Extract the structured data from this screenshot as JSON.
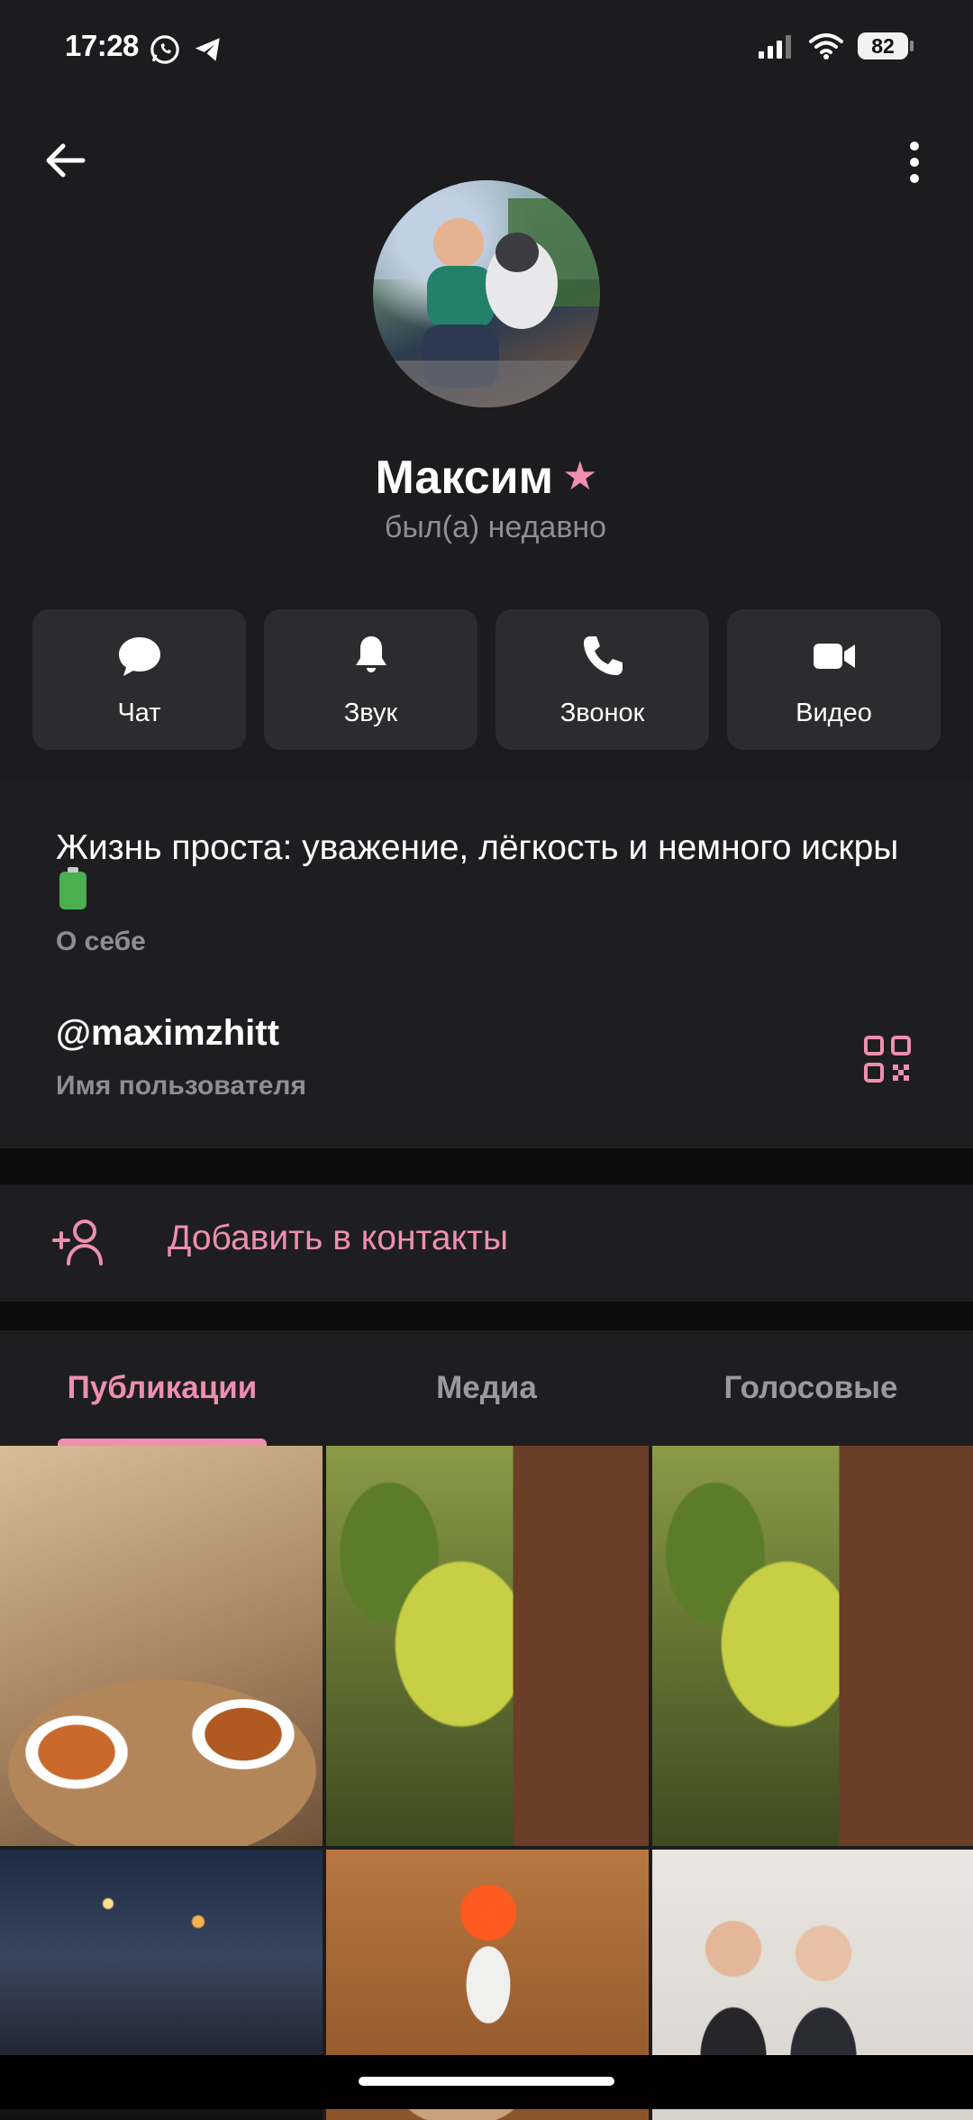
{
  "status_bar": {
    "time": "17:28",
    "battery": "82"
  },
  "profile": {
    "name": "Максим",
    "last_seen": "был(а) недавно",
    "accent_color": "#ee8fb0"
  },
  "actions": [
    {
      "label": "Чат",
      "icon": "chat-bubble-icon"
    },
    {
      "label": "Звук",
      "icon": "bell-icon"
    },
    {
      "label": "Звонок",
      "icon": "phone-icon"
    },
    {
      "label": "Видео",
      "icon": "video-camera-icon"
    }
  ],
  "info": {
    "bio": "Жизнь проста: уважение, лёгкость и немного искры",
    "bio_label": "О себе",
    "username": "@maximzhitt",
    "username_label": "Имя пользователя"
  },
  "add_contact_label": "Добавить в контакты",
  "tabs": [
    {
      "label": "Публикации",
      "active": true
    },
    {
      "label": "Медиа",
      "active": false
    },
    {
      "label": "Голосовые",
      "active": false
    }
  ]
}
